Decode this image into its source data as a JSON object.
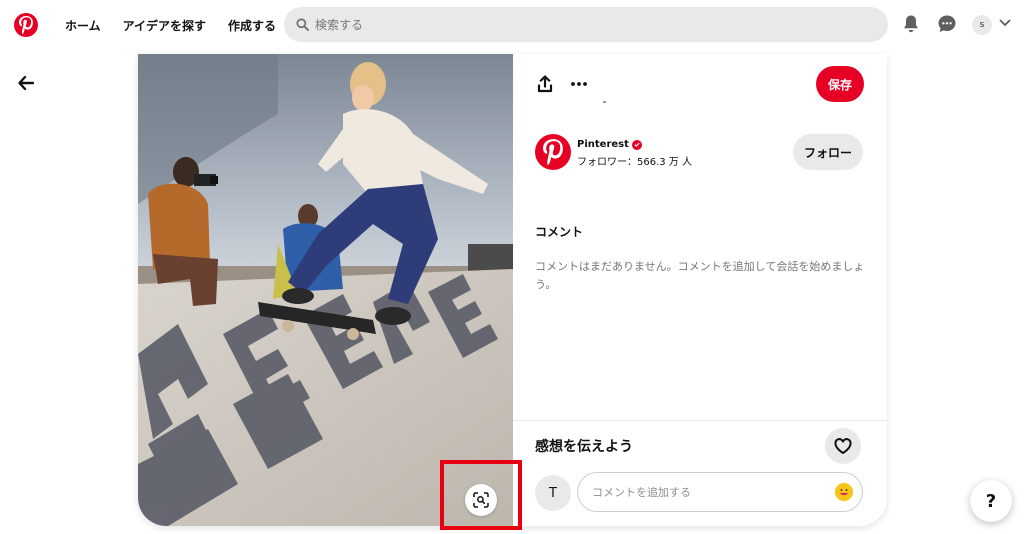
{
  "header": {
    "nav": [
      "ホーム",
      "アイデアを探す",
      "作成する"
    ],
    "search_placeholder": "検索する",
    "user_initial": "s"
  },
  "pin": {
    "save_label": "保存",
    "profile": {
      "name": "Pinterest",
      "followers": "フォロワー：566.3 万 人",
      "follow_label": "フォロー"
    },
    "comments": {
      "title": "コメント",
      "empty_text": "コメントはまだありません。コメントを追加して会話を始めましょう。"
    },
    "feedback": {
      "prompt": "感想を伝えよう",
      "user_initial": "T",
      "comment_placeholder": "コメントを追加する"
    },
    "photo_letters": "HERE"
  },
  "help_label": "?",
  "colors": {
    "brand_red": "#e60023",
    "highlight_red": "#e60012",
    "light_gray": "#e9e9e9"
  }
}
